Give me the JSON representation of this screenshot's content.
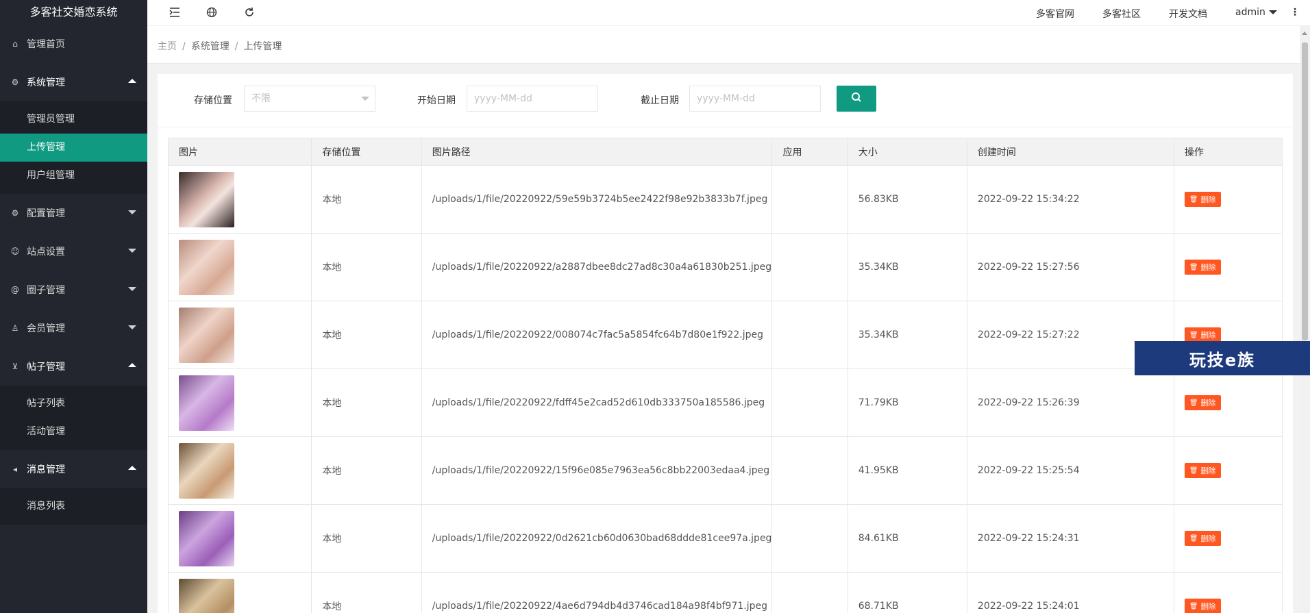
{
  "app": {
    "title": "多客社交婚恋系统"
  },
  "sidebar": {
    "items": [
      {
        "label": "管理首页",
        "icon": "home-icon",
        "open": false
      },
      {
        "label": "系统管理",
        "icon": "gear-icon",
        "open": true,
        "children": [
          "管理员管理",
          "上传管理",
          "用户组管理"
        ],
        "active_child": 1
      },
      {
        "label": "配置管理",
        "icon": "gear-icon",
        "open": false
      },
      {
        "label": "站点设置",
        "icon": "smile-icon",
        "open": false
      },
      {
        "label": "圈子管理",
        "icon": "at-icon",
        "open": false
      },
      {
        "label": "会员管理",
        "icon": "user-icon",
        "open": false
      },
      {
        "label": "帖子管理",
        "icon": "cart-icon",
        "open": true,
        "children": [
          "帖子列表",
          "活动管理"
        ]
      },
      {
        "label": "消息管理",
        "icon": "speaker-icon",
        "open": true,
        "children": [
          "消息列表"
        ]
      }
    ]
  },
  "header": {
    "icons": [
      "menu-fold-icon",
      "globe-icon",
      "refresh-icon"
    ],
    "links": [
      "多客官网",
      "多客社区",
      "开发文档"
    ],
    "user": "admin",
    "more": "⋮"
  },
  "breadcrumb": [
    "主页",
    "系统管理",
    "上传管理"
  ],
  "search": {
    "storage_label": "存储位置",
    "storage_value": "不限",
    "start_label": "开始日期",
    "start_placeholder": "yyyy-MM-dd",
    "end_label": "截止日期",
    "end_placeholder": "yyyy-MM-dd"
  },
  "table": {
    "columns": [
      "图片",
      "存储位置",
      "图片路径",
      "应用",
      "大小",
      "创建时间",
      "操作"
    ],
    "delete_label": "删除",
    "rows": [
      {
        "storage": "本地",
        "path": "/uploads/1/file/20220922/59e59b3724b5ee2422f98e92b3833b7f.jpeg",
        "app": "",
        "size": "56.83KB",
        "time": "2022-09-22 15:34:22"
      },
      {
        "storage": "本地",
        "path": "/uploads/1/file/20220922/a2887dbee8dc27ad8c30a4a61830b251.jpeg",
        "app": "",
        "size": "35.34KB",
        "time": "2022-09-22 15:27:56"
      },
      {
        "storage": "本地",
        "path": "/uploads/1/file/20220922/008074c7fac5a5854fc64b7d80e1f922.jpeg",
        "app": "",
        "size": "35.34KB",
        "time": "2022-09-22 15:27:22"
      },
      {
        "storage": "本地",
        "path": "/uploads/1/file/20220922/fdff45e2cad52d610db333750a185586.jpeg",
        "app": "",
        "size": "71.79KB",
        "time": "2022-09-22 15:26:39"
      },
      {
        "storage": "本地",
        "path": "/uploads/1/file/20220922/15f96e085e7963ea56c8bb22003edaa4.jpeg",
        "app": "",
        "size": "41.95KB",
        "time": "2022-09-22 15:25:54"
      },
      {
        "storage": "本地",
        "path": "/uploads/1/file/20220922/0d2621cb60d0630bad68ddde81cee97a.jpeg",
        "app": "",
        "size": "84.61KB",
        "time": "2022-09-22 15:24:31"
      },
      {
        "storage": "本地",
        "path": "/uploads/1/file/20220922/4ae6d794db4d3746cad184a98f4bf971.jpeg",
        "app": "",
        "size": "68.71KB",
        "time": "2022-09-22 15:24:01"
      }
    ]
  },
  "watermark": "玩技e族",
  "colors": {
    "accent": "#119a82",
    "sidebar": "#23262e",
    "danger": "#ff5722"
  }
}
